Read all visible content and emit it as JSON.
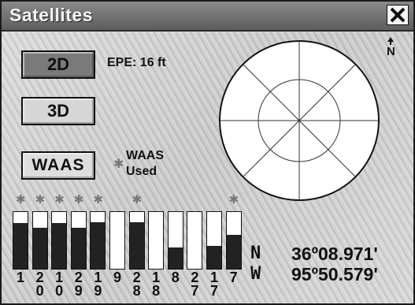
{
  "window": {
    "title": "Satellites"
  },
  "controls": {
    "btn_2d": "2D",
    "btn_3d": "3D",
    "btn_waas": "WAAS",
    "epe": "EPE: 16 ft",
    "waas_used_line1": "WAAS",
    "waas_used_line2": "Used"
  },
  "north_label": "N",
  "sky_satellites": [
    {
      "id": "29"
    },
    {
      "id": "19"
    },
    {
      "id": "17"
    },
    {
      "id": "7"
    },
    {
      "id": "27"
    },
    {
      "id": "10"
    },
    {
      "id": "9"
    },
    {
      "id": "20"
    },
    {
      "id": "28"
    },
    {
      "id": "18"
    },
    {
      "id": "8"
    },
    {
      "id": "1"
    }
  ],
  "signal_bars": [
    {
      "digits": [
        "1"
      ],
      "level": 0.8,
      "used": true
    },
    {
      "digits": [
        "2",
        "0"
      ],
      "level": 0.72,
      "used": true
    },
    {
      "digits": [
        "1",
        "0"
      ],
      "level": 0.8,
      "used": true
    },
    {
      "digits": [
        "2",
        "9"
      ],
      "level": 0.72,
      "used": true
    },
    {
      "digits": [
        "1",
        "9"
      ],
      "level": 0.82,
      "used": true
    },
    {
      "digits": [
        "9"
      ],
      "level": 0.0,
      "used": false
    },
    {
      "digits": [
        "2",
        "8"
      ],
      "level": 0.82,
      "used": true
    },
    {
      "digits": [
        "1",
        "8"
      ],
      "level": 0.0,
      "used": false
    },
    {
      "digits": [
        "8"
      ],
      "level": 0.38,
      "used": false
    },
    {
      "digits": [
        "2",
        "7"
      ],
      "level": 0.0,
      "used": false
    },
    {
      "digits": [
        "1",
        "7"
      ],
      "level": 0.4,
      "used": false
    },
    {
      "digits": [
        "7"
      ],
      "level": 0.6,
      "used": true
    }
  ],
  "position": {
    "lat_prefix": "N",
    "lat_value": "36º08.971'",
    "lon_prefix": "W",
    "lon_value": "95º50.579'"
  }
}
